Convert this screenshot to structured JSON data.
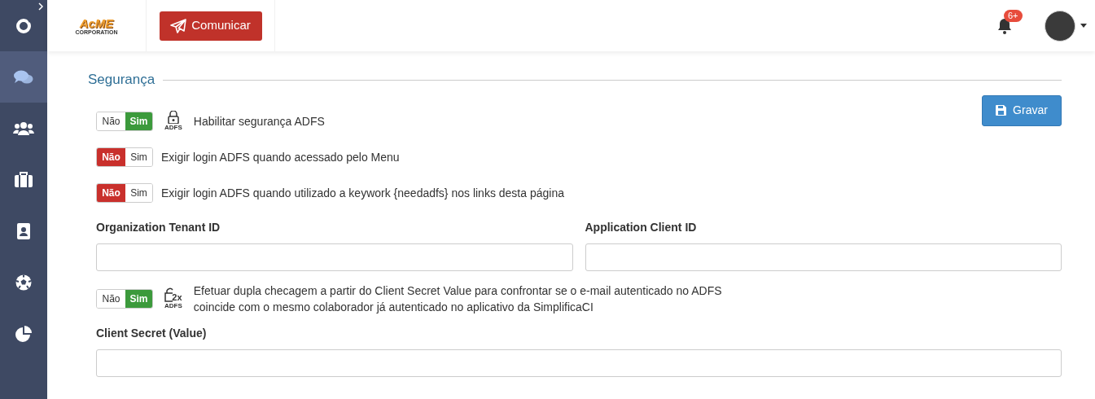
{
  "sidebar": {
    "items": [
      {
        "selected": true
      },
      {
        "selected": false
      },
      {
        "selected": false
      },
      {
        "selected": false
      },
      {
        "selected": false
      },
      {
        "selected": false
      }
    ]
  },
  "header": {
    "logo": {
      "word": "AcME",
      "sub": "CORPORATION"
    },
    "action_button": "Comunicar",
    "notifications_badge": "6+"
  },
  "section": {
    "title": "Segurança",
    "save_button": "Gravar"
  },
  "settings": [
    {
      "kind": "toggle",
      "off_label": "Não",
      "on_label": "Sim",
      "on": true,
      "icon_caption": "ADFS",
      "text": "Habilitar segurança ADFS"
    },
    {
      "kind": "toggle",
      "off_label": "Não",
      "on_label": "Sim",
      "on": false,
      "text": "Exigir login ADFS quando acessado pelo Menu"
    },
    {
      "kind": "toggle",
      "off_label": "Não",
      "on_label": "Sim",
      "on": false,
      "text": "Exigir login ADFS quando utilizado a keywork {needadfs} nos links desta página"
    },
    {
      "kind": "fields",
      "fields": [
        {
          "label": "Organization Tenant ID"
        },
        {
          "label": "Application Client ID"
        }
      ]
    },
    {
      "kind": "toggle",
      "off_label": "Não",
      "on_label": "Sim",
      "on": true,
      "icon_badge": "2x",
      "icon_caption": "ADFS",
      "text": "Efetuar dupla checagem a partir do Client Secret Value para confrontar se o e-mail autenticado no ADFS coincide com o mesmo colaborador já autenticado no aplicativo da SimplificaCI"
    },
    {
      "kind": "fields",
      "fields": [
        {
          "label": "Client Secret (Value)"
        }
      ]
    }
  ]
}
